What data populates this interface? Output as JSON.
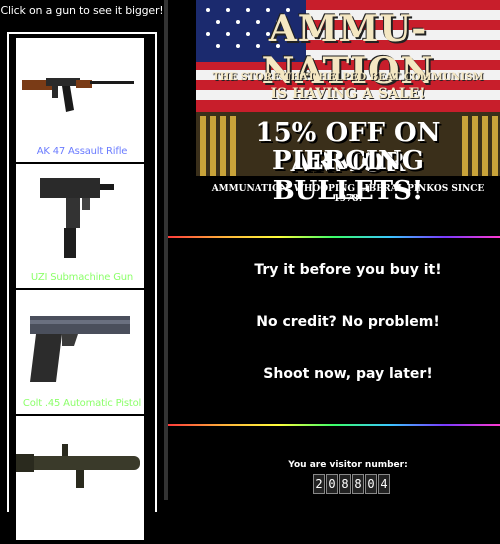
{
  "sidebar": {
    "title": "Click on a gun to see it bigger!",
    "guns": [
      {
        "label": "AK 47 Assault Rifle",
        "icon": "rifle-icon"
      },
      {
        "label": "UZI Submachine Gun",
        "icon": "smg-icon"
      },
      {
        "label": "Colt .45 Automatic Pistol",
        "icon": "pistol-icon"
      },
      {
        "label": "",
        "icon": "rocket-launcher-icon"
      }
    ]
  },
  "banner": {
    "title": "AMMU-NATION",
    "tagline_1": "THE STORE THAT HELPED BEAT COMMUNISM",
    "tagline_2": "IS HAVING A SALE!",
    "promo_line_1": "15% OFF ON ARMOR",
    "promo_line_2": "PIERCING BULLETS!",
    "slogan": "AMMUNATION. WHOOPING LIBERAL PINKOS SINCE 1978!"
  },
  "pitch": {
    "line_1": "Try it before you buy it!",
    "line_2": "No credit? No problem!",
    "line_3": "Shoot now, pay later!"
  },
  "visitor": {
    "label": "You are visitor number:",
    "digits": [
      "2",
      "0",
      "8",
      "8",
      "0",
      "4"
    ]
  },
  "colors": {
    "background": "#000000",
    "caption_blue": "#6b7cff",
    "caption_green": "#8cff6a"
  }
}
